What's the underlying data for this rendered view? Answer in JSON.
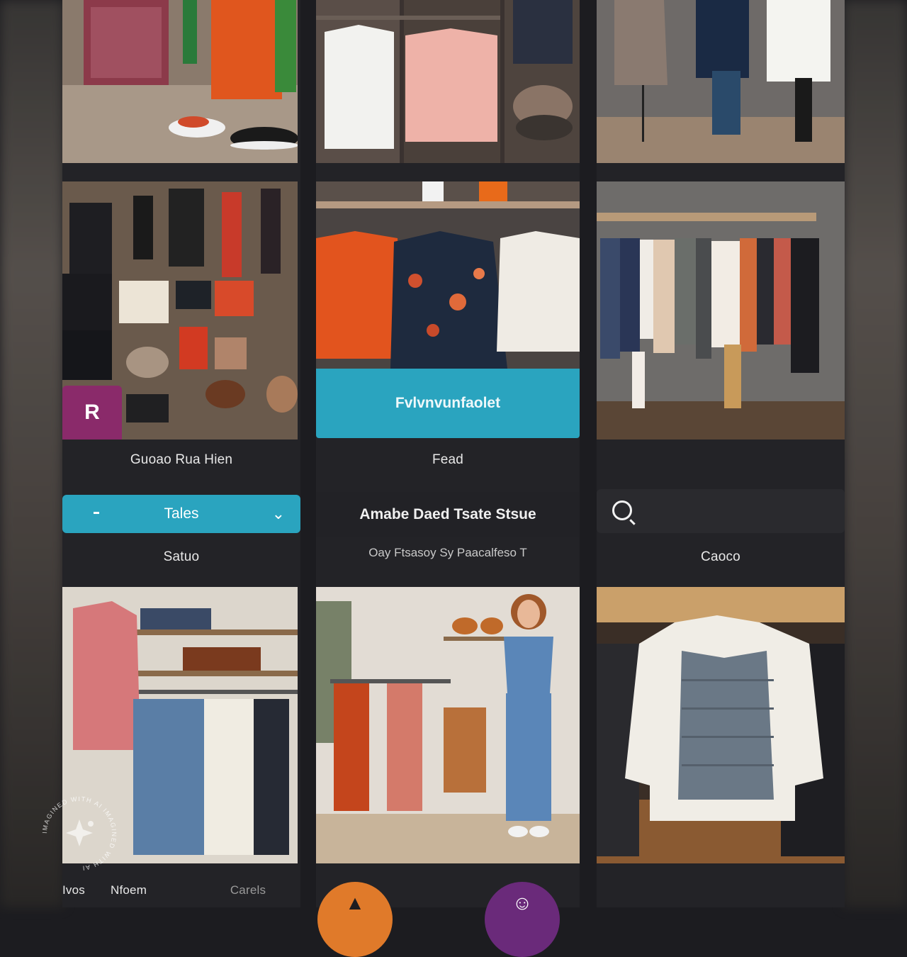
{
  "cta_label": "Fvlvnvunfaolet",
  "brand_badge": "R",
  "captions": {
    "row2_left": "Guoao Rua Hien",
    "row2_mid": "Fead",
    "filter_left": "Satuo",
    "filter_right": "Caoco",
    "bottom_left_a": "Ivos",
    "bottom_left_b": "Nfoem",
    "bottom_mid": "Carels"
  },
  "select": {
    "value": "Tales"
  },
  "store": {
    "title": "Amabe Daed Tsate  Stsue",
    "subtitle": "Oay Ftsasoy  Sy Paacalfeso   T"
  },
  "search": {
    "placeholder": ""
  },
  "watermark": {
    "text": "IMAGINED WITH AI  IMAGINED WITH AI"
  },
  "colors": {
    "accent": "#2aa4bf",
    "badge": "#8a2a6a",
    "fab_orange": "#e07a2a",
    "fab_purple": "#6a2a7a",
    "background": "#1c1c20"
  },
  "icons": [
    "search-icon",
    "chevron-down-icon",
    "hanger-icon",
    "profile-icon"
  ]
}
